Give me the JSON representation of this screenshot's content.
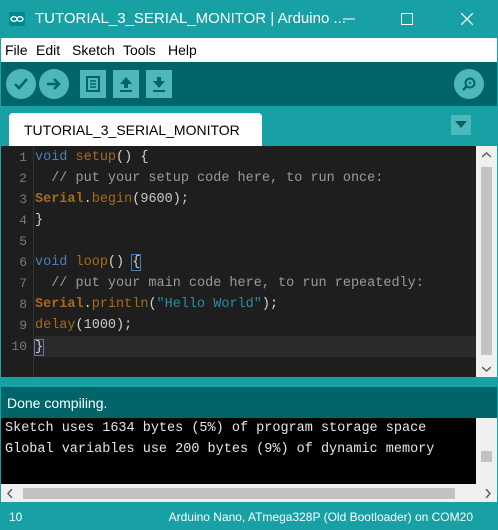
{
  "window": {
    "title": "TUTORIAL_3_SERIAL_MONITOR | Arduino ...",
    "app_icon": "arduino-infinity-icon"
  },
  "menu": [
    "File",
    "Edit",
    "Sketch",
    "Tools",
    "Help"
  ],
  "toolbar": {
    "verify": "check-icon",
    "upload": "arrow-right-icon",
    "new": "new-file-icon",
    "open": "arrow-up-icon",
    "save": "arrow-down-icon",
    "serial_monitor": "magnifier-icon"
  },
  "tab": {
    "label": "TUTORIAL_3_SERIAL_MONITOR"
  },
  "editor": {
    "line_numbers": [
      "1",
      "2",
      "3",
      "4",
      "5",
      "6",
      "7",
      "8",
      "9",
      "10"
    ],
    "current_line": 10
  },
  "status": {
    "text": "Done compiling."
  },
  "console": {
    "lines": [
      "Sketch uses 1634 bytes (5%) of program storage space",
      "Global variables use 200 bytes (9%) of dynamic memory"
    ]
  },
  "footer": {
    "line": "10",
    "board": "Arduino Nano, ATmega328P (Old Bootloader) on COM20"
  },
  "colors": {
    "teal": "#17a1a5",
    "dark_teal": "#006468",
    "button": "#4db7bb",
    "editor_bg": "#1e1e1e"
  }
}
